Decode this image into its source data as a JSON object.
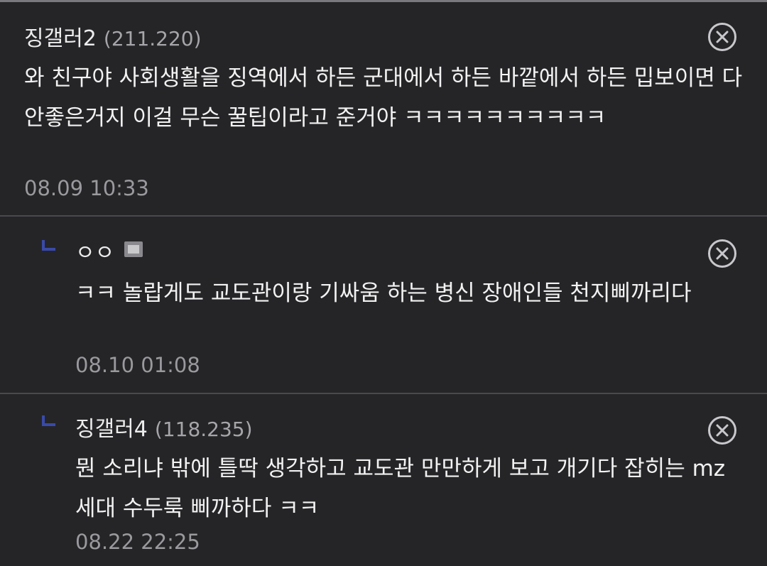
{
  "comments": [
    {
      "nick": "징갤러2",
      "ip": "(211.220)",
      "text": "와 친구야 사회생활을 징역에서 하든 군대에서 하든 바깥에서 하든 밉보이면 다 안좋은거지 이걸 무슨 꿀팁이라고 준거야 ㅋㅋㅋㅋㅋㅋㅋㅋㅋㅋ",
      "date": "08.09 10:33"
    },
    {
      "nick": "ㅇㅇ",
      "ip": "",
      "text": "ㅋㅋ 놀랍게도 교도관이랑 기싸움 하는 병신 장애인들 천지삐까리다",
      "date": "08.10 01:08",
      "reply": true
    },
    {
      "nick": "징갤러4",
      "ip": "(118.235)",
      "text": "뭔 소리냐 밖에 틀딱 생각하고 교도관 만만하게 보고 개기다 잡히는 mz 세대 수두룩 삐까하다 ㅋㅋ",
      "date": "08.22 22:25",
      "reply": true
    }
  ],
  "icons": {
    "delete": "close-circle-icon",
    "reply": "reply-arrow-icon",
    "gallery": "gallery-icon"
  },
  "colors": {
    "background": "#252528",
    "text": "#ececec",
    "meta": "#9a9a9e",
    "reply_mark": "#3a4aa8"
  }
}
